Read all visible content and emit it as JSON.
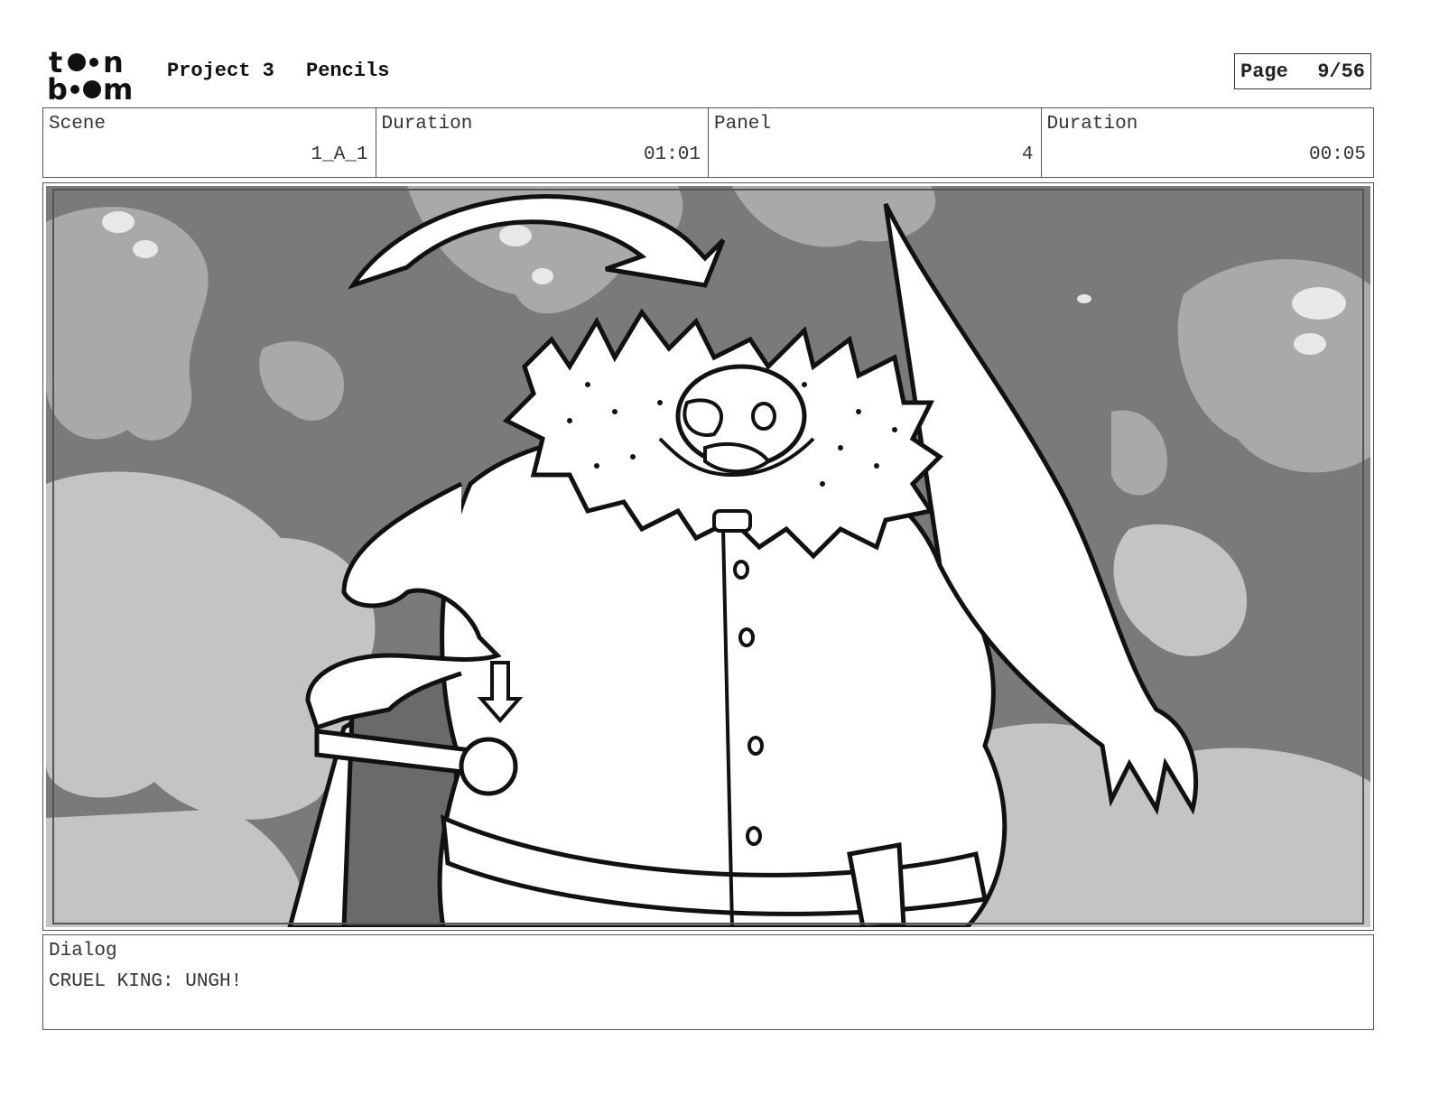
{
  "header": {
    "logo_text_top": "toon",
    "logo_text_bottom": "boom",
    "project": "Project 3",
    "stage": "Pencils",
    "page_label": "Page",
    "page_value": "9/56"
  },
  "meta": [
    {
      "label": "Scene",
      "value": "1_A_1"
    },
    {
      "label": "Duration",
      "value": "01:01"
    },
    {
      "label": "Panel",
      "value": "4"
    },
    {
      "label": "Duration",
      "value": "00:05"
    }
  ],
  "panel": {
    "description": "Storyboard sketch: a large cruel king with fur collar and cape leans on a sword hilt against a smoky background; action arrows indicate movement."
  },
  "dialog": {
    "label": "Dialog",
    "text": "CRUEL KING: UNGH!"
  }
}
